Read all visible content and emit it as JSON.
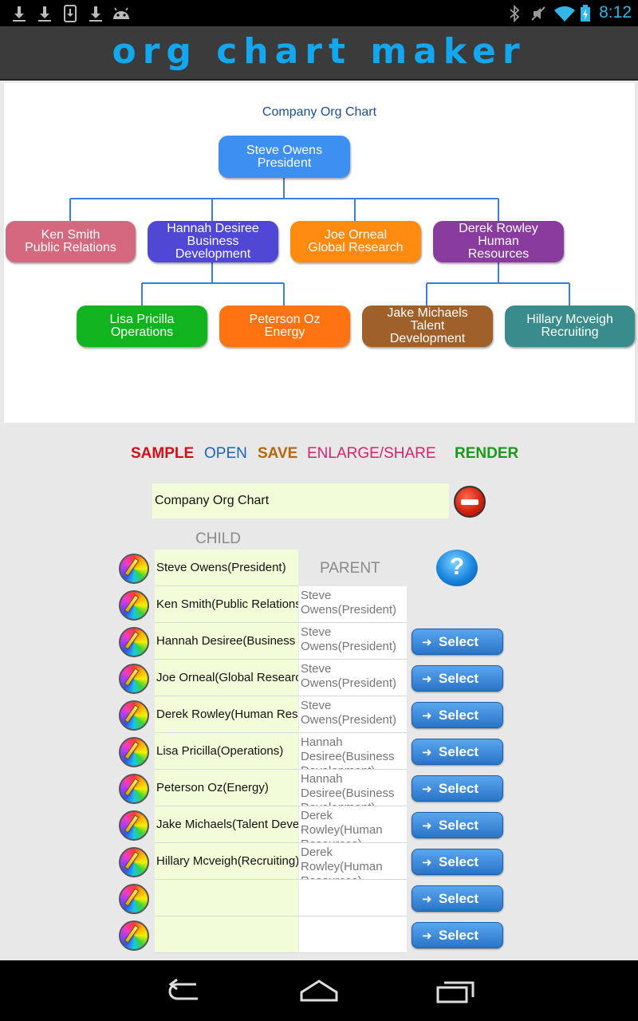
{
  "status_bar": {
    "time": "8:12",
    "left_icons": [
      "download-icon",
      "download-icon",
      "download-icon",
      "download-icon",
      "android-icon"
    ],
    "right_icons": [
      "bluetooth-icon",
      "mute-icon",
      "wifi-icon",
      "battery-icon"
    ]
  },
  "app": {
    "title": "Org Chart Maker",
    "accent": "#12a8f0"
  },
  "chart": {
    "title": "Company Org Chart",
    "nodes": [
      {
        "id": "steve",
        "lines": [
          "Steve Owens",
          "President"
        ],
        "color": "#3d8ff2"
      },
      {
        "id": "ken",
        "lines": [
          "Ken Smith",
          "Public Relations"
        ],
        "color": "#d4687e"
      },
      {
        "id": "hannah",
        "lines": [
          "Hannah Desiree",
          "Business",
          "Development"
        ],
        "color": "#5047d4"
      },
      {
        "id": "joe",
        "lines": [
          "Joe Orneal",
          "Global Research"
        ],
        "color": "#ff8a10"
      },
      {
        "id": "derek",
        "lines": [
          "Derek Rowley",
          "Human",
          "Resources"
        ],
        "color": "#8a3b9e"
      },
      {
        "id": "lisa",
        "lines": [
          "Lisa Pricilla",
          "Operations"
        ],
        "color": "#11b41e"
      },
      {
        "id": "peterson",
        "lines": [
          "Peterson Oz",
          "Energy"
        ],
        "color": "#ff7410"
      },
      {
        "id": "jake",
        "lines": [
          "Jake Michaels",
          "Talent",
          "Development"
        ],
        "color": "#a0602a"
      },
      {
        "id": "hillary",
        "lines": [
          "Hillary Mcveigh",
          "Recruiting"
        ],
        "color": "#3a8c8c"
      }
    ]
  },
  "actions": {
    "sample": {
      "label": "SAMPLE",
      "color": "#d0101a"
    },
    "open": {
      "label": "OPEN",
      "color": "#1d63b8"
    },
    "save": {
      "label": "SAVE",
      "color": "#b8660c"
    },
    "enlarge": {
      "label": "ENLARGE/SHARE",
      "color": "#d1256e"
    },
    "render": {
      "label": "RENDER",
      "color": "#1a9a1a"
    }
  },
  "editor": {
    "chart_title_value": "Company Org Chart",
    "child_header": "CHILD",
    "parent_header": "PARENT",
    "help_label": "?",
    "select_label": "Select",
    "rows": [
      {
        "child": "Steve Owens(President)",
        "parent": "",
        "has_select": false
      },
      {
        "child": "Ken Smith(Public Relations)",
        "parent": "Steve Owens(President)",
        "has_select": false
      },
      {
        "child": "Hannah Desiree(Business Development)",
        "parent": "Steve Owens(President)",
        "has_select": true
      },
      {
        "child": "Joe Orneal(Global Research)",
        "parent": "Steve Owens(President)",
        "has_select": true
      },
      {
        "child": "Derek Rowley(Human Resources)",
        "parent": "Steve Owens(President)",
        "has_select": true
      },
      {
        "child": "Lisa Pricilla(Operations)",
        "parent": "Hannah Desiree(Business Development)",
        "has_select": true
      },
      {
        "child": "Peterson Oz(Energy)",
        "parent": "Hannah Desiree(Business Development)",
        "has_select": true
      },
      {
        "child": "Jake Michaels(Talent Development)",
        "parent": "Derek Rowley(Human Resources)",
        "has_select": true
      },
      {
        "child": "Hillary Mcveigh(Recruiting)",
        "parent": "Derek Rowley(Human Resources)",
        "has_select": true
      },
      {
        "child": "",
        "parent": "",
        "has_select": true
      },
      {
        "child": "",
        "parent": "",
        "has_select": true
      }
    ]
  },
  "nav": {
    "icons": [
      "back-icon",
      "home-icon",
      "recent-apps-icon"
    ]
  }
}
